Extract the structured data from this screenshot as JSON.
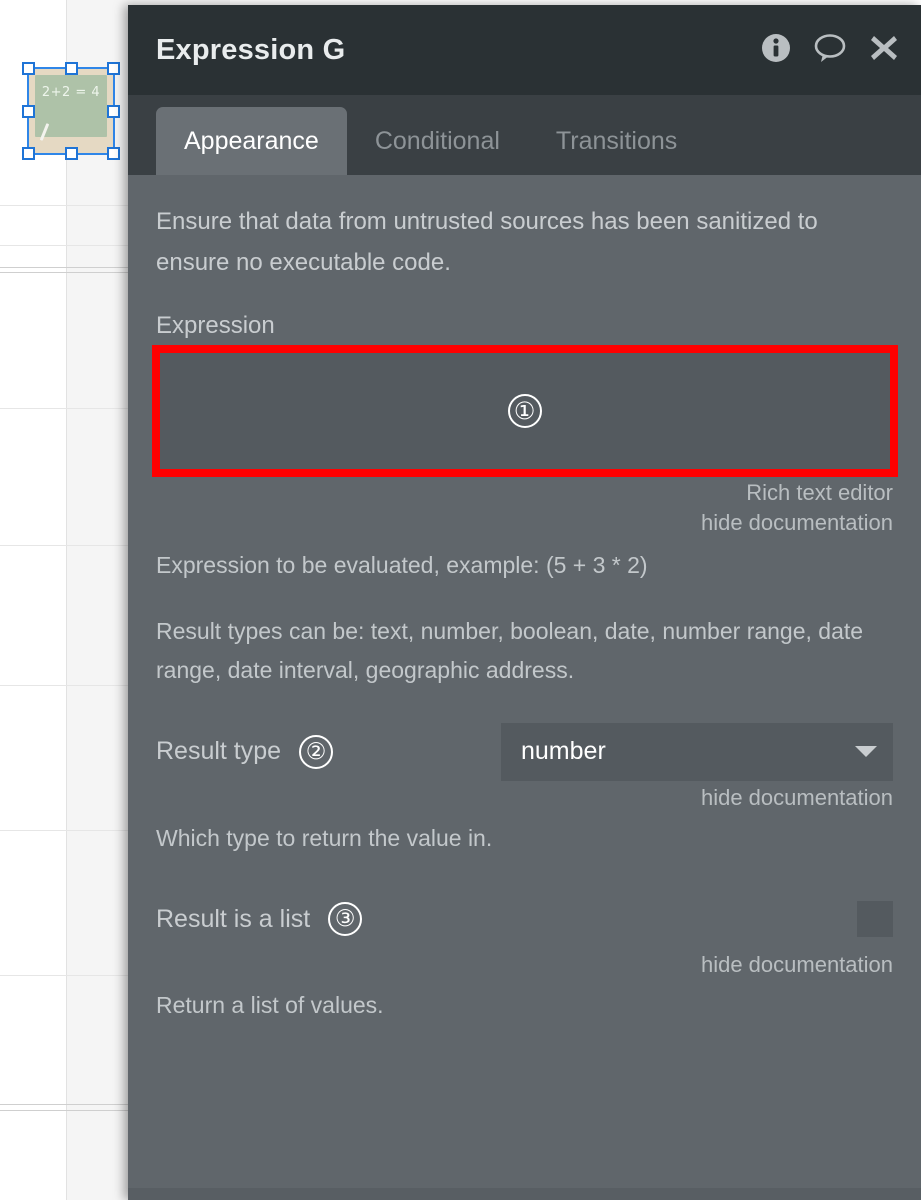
{
  "canvas": {
    "selected_element": {
      "name": "chalkboard-image",
      "equation_text": "2+2 = 4"
    }
  },
  "dialog": {
    "title": "Expression G",
    "icons": {
      "info": "info-icon",
      "comment": "comment-icon",
      "close": "close-icon"
    },
    "tabs": [
      {
        "label": "Appearance",
        "active": true
      },
      {
        "label": "Conditional",
        "active": false
      },
      {
        "label": "Transitions",
        "active": false
      }
    ],
    "security_note": "Ensure that data from untrusted sources has been sanitized to ensure no executable code.",
    "expression_field": {
      "label": "Expression",
      "value": "",
      "placeholder": "",
      "annotation_badge": "①",
      "rich_text_editor_link": "Rich text editor",
      "hide_documentation_link": "hide documentation",
      "documentation": "Expression to be evaluated, example: (5 + 3 * 2)",
      "documentation_2": "Result types can be: text, number, boolean, date, number range, date range, date interval, geographic address."
    },
    "result_type_field": {
      "label": "Result type",
      "annotation_badge": "②",
      "selected_value": "number",
      "hide_documentation_link": "hide documentation",
      "documentation": "Which type to return the value in."
    },
    "result_is_list_field": {
      "label": "Result is a list",
      "annotation_badge": "③",
      "checked": false,
      "hide_documentation_link": "hide documentation",
      "documentation": "Return a list of values."
    }
  },
  "colors": {
    "titlebar": "#2a3134",
    "tabstrip": "#3a4044",
    "body": "#60666b",
    "input": "#545a5f",
    "annotation_red": "#ff0000",
    "selection_blue": "#2f86e8"
  }
}
